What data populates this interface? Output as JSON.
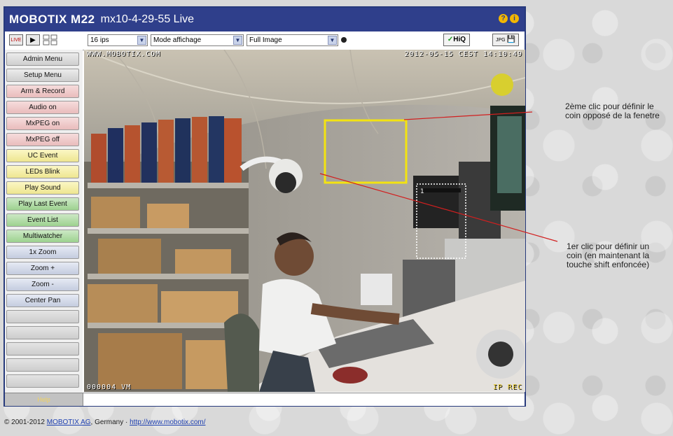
{
  "title": {
    "brand": "MOBOTIX M22",
    "camera": "mx10-4-29-55 Live",
    "help_icon": "question-icon",
    "info_icon": "info-icon"
  },
  "toolbar": {
    "live_label": "LIVE",
    "play_icon": "play-icon",
    "grid_icon": "grid-icon",
    "fps_value": "16 ips",
    "mode_value": "Mode affichage",
    "image_value": "Full Image",
    "hiq_label": "HiQ",
    "jpg_label": "JPG"
  },
  "sidebar": {
    "items": [
      {
        "label": "Admin Menu",
        "color": "gray"
      },
      {
        "label": "Setup Menu",
        "color": "gray"
      },
      {
        "label": "Arm & Record",
        "color": "pink"
      },
      {
        "label": "Audio on",
        "color": "pink"
      },
      {
        "label": "MxPEG on",
        "color": "pink"
      },
      {
        "label": "MxPEG off",
        "color": "pink"
      },
      {
        "label": "UC Event",
        "color": "yellow"
      },
      {
        "label": "LEDs Blink",
        "color": "yellow"
      },
      {
        "label": "Play Sound",
        "color": "yellow"
      },
      {
        "label": "Play Last Event",
        "color": "green"
      },
      {
        "label": "Event List",
        "color": "green"
      },
      {
        "label": "Multiwatcher",
        "color": "green"
      },
      {
        "label": "1x Zoom",
        "color": "blue"
      },
      {
        "label": "Zoom +",
        "color": "blue"
      },
      {
        "label": "Zoom -",
        "color": "blue"
      },
      {
        "label": "Center Pan",
        "color": "blue"
      }
    ],
    "empty_slots": 5,
    "footer": "Help"
  },
  "video": {
    "osd_top_left": "WWW.MOBOTIX.COM",
    "osd_top_right": "2012-05-15 CEST 14:10:49",
    "osd_bottom_left": "000004 VM",
    "osd_bottom_right": "IP REC",
    "window_label": "1"
  },
  "annotations": {
    "second_click": "2ème clic pour définir le coin opposé de la fenetre",
    "first_click_line1": "1er clic pour définir un",
    "first_click_line2": "coin (en maintenant la",
    "first_click_line3": "touche shift enfoncée)"
  },
  "footer": {
    "copyright_prefix": "© 2001-2012",
    "company_link": "MOBOTIX AG",
    "copyright_mid": ", Germany ·",
    "website_link": "http://www.mobotix.com/"
  },
  "colors": {
    "title_bg": "#2f3f8b",
    "selection_yellow": "#f3e311",
    "annotation_red": "#d21f1f"
  }
}
